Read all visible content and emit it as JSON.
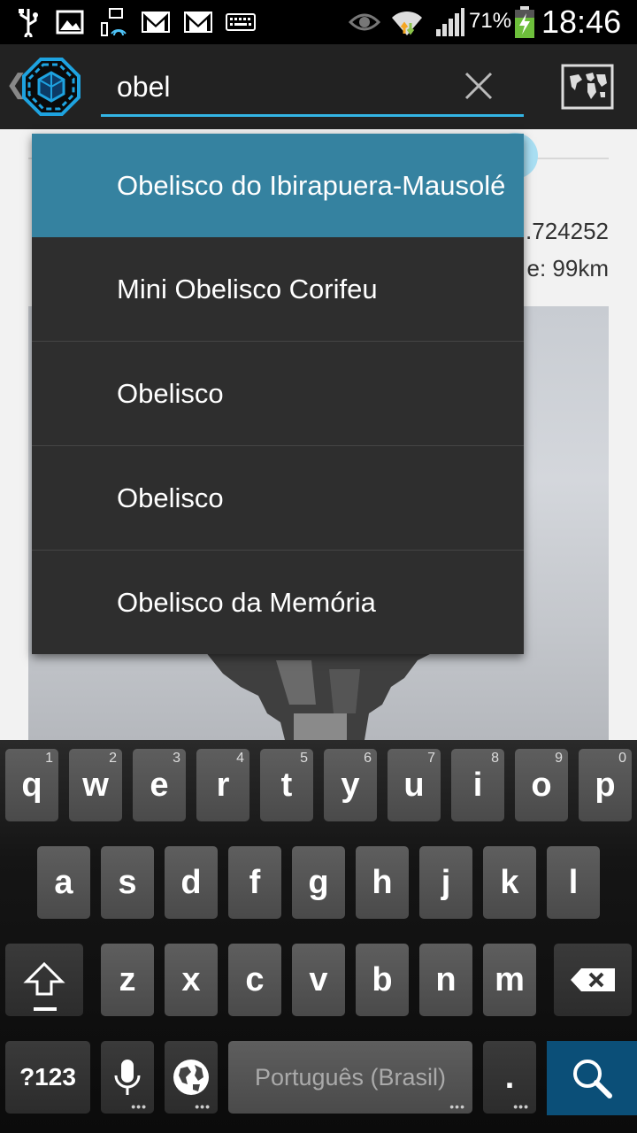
{
  "status_bar": {
    "battery_percent": "71%",
    "time": "18:46",
    "icons": [
      "usb-icon",
      "image-icon",
      "wifi-data-icon",
      "gmail-icon",
      "gmail-icon",
      "keyboard-icon",
      "eye-icon",
      "wifi-icon",
      "signal-icon",
      "battery-charging-icon"
    ]
  },
  "action_bar": {
    "search_value": "obel",
    "icons": [
      "back-chevron-icon",
      "app-logo-icon",
      "clear-icon",
      "map-icon"
    ]
  },
  "content": {
    "coordinate_fragment": ".724252",
    "distance_fragment": "e: 99km"
  },
  "suggestions": [
    {
      "label": "Obelisco do Ibirapuera-Mausolé"
    },
    {
      "label": "Mini Obelisco Corifeu"
    },
    {
      "label": "Obelisco"
    },
    {
      "label": "Obelisco"
    },
    {
      "label": "Obelisco da Memória"
    }
  ],
  "keyboard": {
    "row1": [
      {
        "key": "q",
        "hint": "1"
      },
      {
        "key": "w",
        "hint": "2"
      },
      {
        "key": "e",
        "hint": "3"
      },
      {
        "key": "r",
        "hint": "4"
      },
      {
        "key": "t",
        "hint": "5"
      },
      {
        "key": "y",
        "hint": "6"
      },
      {
        "key": "u",
        "hint": "7"
      },
      {
        "key": "i",
        "hint": "8"
      },
      {
        "key": "o",
        "hint": "9"
      },
      {
        "key": "p",
        "hint": "0"
      }
    ],
    "row2": [
      "a",
      "s",
      "d",
      "f",
      "g",
      "h",
      "j",
      "k",
      "l"
    ],
    "row3": [
      "z",
      "x",
      "c",
      "v",
      "b",
      "n",
      "m"
    ],
    "symbols_label": "?123",
    "space_label": "Português (Brasil)",
    "period_label": ".",
    "icons": [
      "shift-icon",
      "backspace-icon",
      "microphone-icon",
      "globe-icon",
      "search-icon"
    ]
  }
}
